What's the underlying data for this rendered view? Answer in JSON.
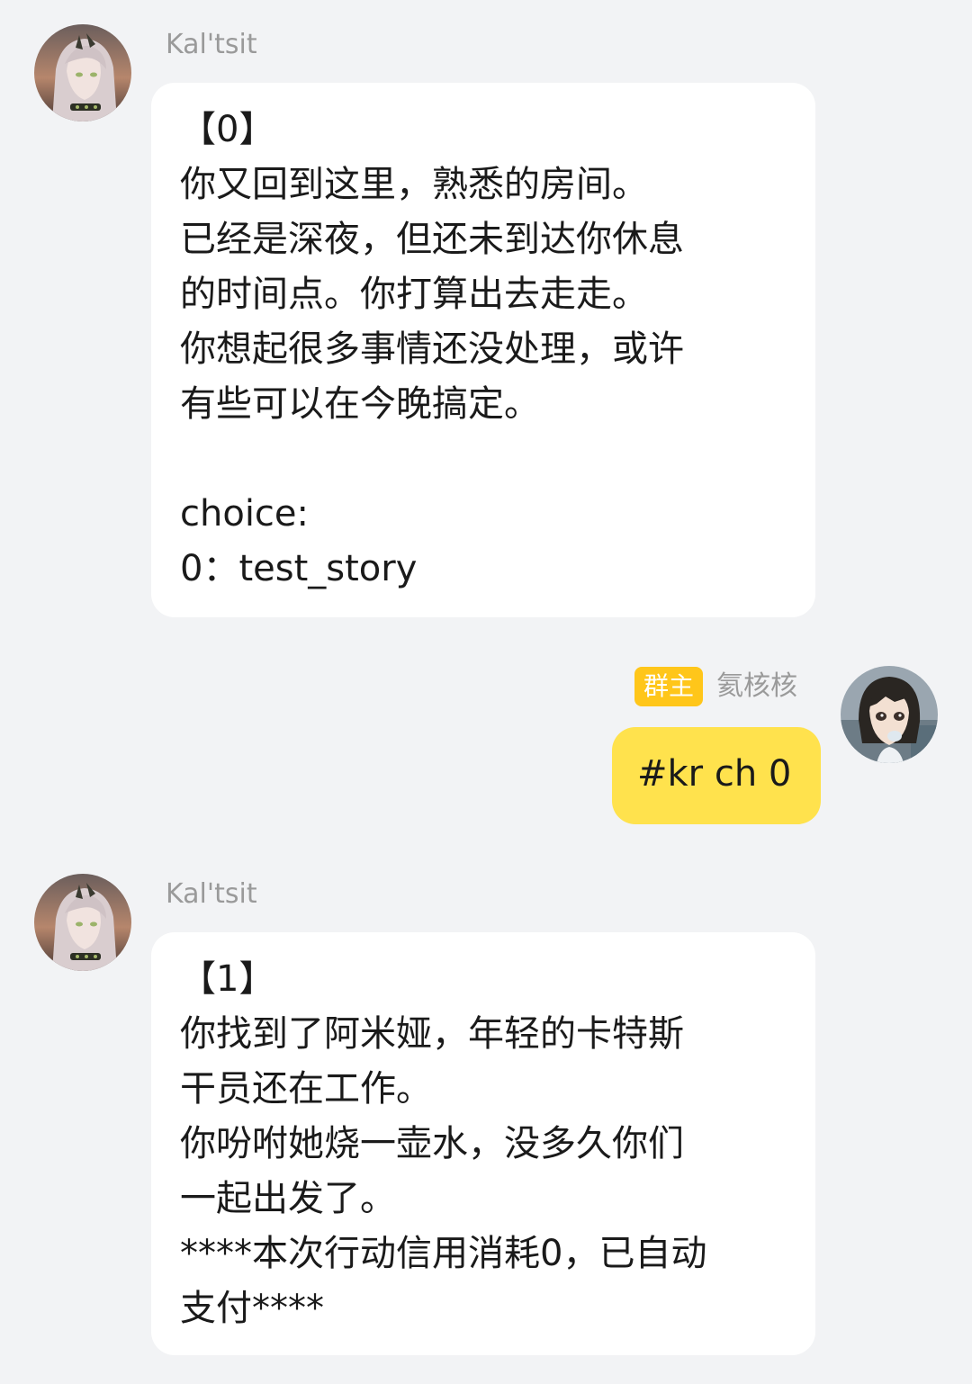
{
  "messages": [
    {
      "sender": "Kal'tsit",
      "avatar": "kaltsit-avatar",
      "lines": [
        "【0】",
        "你又回到这里，熟悉的房间。",
        "已经是深夜，但还未到达你休息",
        "的时间点。你打算出去走走。",
        "你想起很多事情还没处理，或许",
        "有些可以在今晚搞定。",
        "",
        "choice:",
        "0：test_story"
      ]
    },
    {
      "sender": "氦核核",
      "role_badge": "群主",
      "avatar": "user-avatar",
      "text": "#kr ch 0"
    },
    {
      "sender": "Kal'tsit",
      "avatar": "kaltsit-avatar",
      "lines": [
        "【1】",
        "你找到了阿米娅，年轻的卡特斯",
        "干员还在工作。",
        "你吩咐她烧一壶水，没多久你们",
        "一起出发了。",
        "****本次行动信用消耗0，已自动",
        "支付****"
      ]
    }
  ],
  "colors": {
    "background": "#f2f3f5",
    "bot_bubble": "#ffffff",
    "self_bubble": "#ffe24d",
    "role_badge": "#ffc61a",
    "sender_name": "#9a9a9a",
    "text": "#1a1a1a"
  }
}
